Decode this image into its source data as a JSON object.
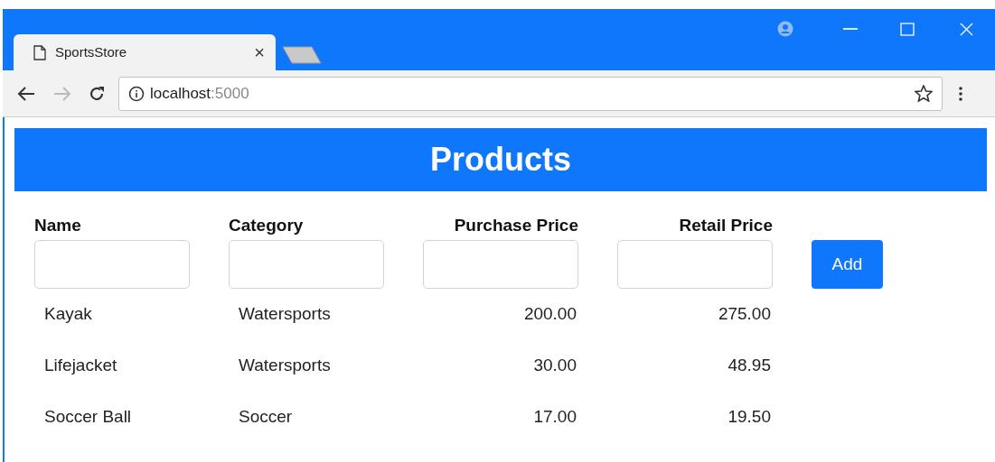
{
  "browser": {
    "tab_title": "SportsStore",
    "tab_close": "×",
    "url_host": "localhost",
    "url_port": ":5000"
  },
  "page": {
    "title": "Products",
    "columns": [
      {
        "label": "Name",
        "kind": "text"
      },
      {
        "label": "Category",
        "kind": "text"
      },
      {
        "label": "Purchase Price",
        "kind": "number"
      },
      {
        "label": "Retail Price",
        "kind": "number"
      }
    ],
    "add_button": "Add",
    "rows": [
      {
        "cells": [
          "Kayak",
          "Watersports",
          "200.00",
          "275.00"
        ]
      },
      {
        "cells": [
          "Lifejacket",
          "Watersports",
          "30.00",
          "48.95"
        ]
      },
      {
        "cells": [
          "Soccer Ball",
          "Soccer",
          "17.00",
          "19.50"
        ]
      }
    ]
  }
}
